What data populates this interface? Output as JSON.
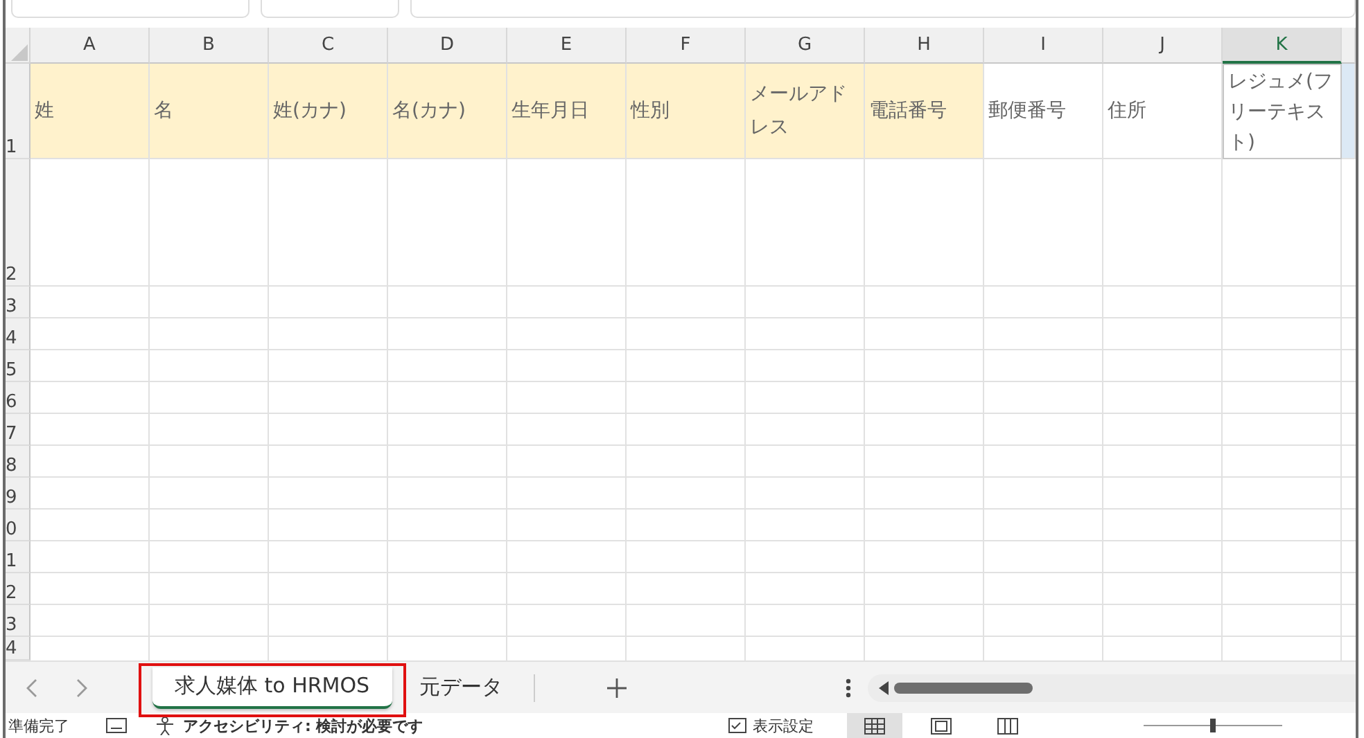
{
  "columns": [
    {
      "letter": "A",
      "header": "姓",
      "highlighted": true,
      "selected": false
    },
    {
      "letter": "B",
      "header": "名",
      "highlighted": true,
      "selected": false
    },
    {
      "letter": "C",
      "header": "姓(カナ)",
      "highlighted": true,
      "selected": false
    },
    {
      "letter": "D",
      "header": "名(カナ)",
      "highlighted": true,
      "selected": false
    },
    {
      "letter": "E",
      "header": "生年月日",
      "highlighted": true,
      "selected": false
    },
    {
      "letter": "F",
      "header": "性別",
      "highlighted": true,
      "selected": false
    },
    {
      "letter": "G",
      "header": "メールアドレス",
      "highlighted": true,
      "selected": false
    },
    {
      "letter": "H",
      "header": "電話番号",
      "highlighted": true,
      "selected": false
    },
    {
      "letter": "I",
      "header": "郵便番号",
      "highlighted": false,
      "selected": false
    },
    {
      "letter": "J",
      "header": "住所",
      "highlighted": false,
      "selected": false
    },
    {
      "letter": "K",
      "header": "レジュメ(フリーテキスト)",
      "highlighted": false,
      "selected": true
    }
  ],
  "row_numbers": [
    "1",
    "2",
    "3",
    "4",
    "5",
    "6",
    "7",
    "8",
    "9",
    "0",
    "1",
    "2",
    "3",
    "4"
  ],
  "sheet_tabs": [
    {
      "label": "求人媒体 to HRMOS",
      "selected": true,
      "outlined": true
    },
    {
      "label": "元データ",
      "selected": false,
      "outlined": false
    }
  ],
  "status_bar": {
    "status": "準備完了",
    "accessibility": "アクセシビリティ: 検討が必要です",
    "display_settings": "表示設定",
    "views": [
      {
        "kind": "normal",
        "selected": true
      },
      {
        "kind": "page-layout",
        "selected": false
      },
      {
        "kind": "page-break",
        "selected": false
      }
    ]
  }
}
